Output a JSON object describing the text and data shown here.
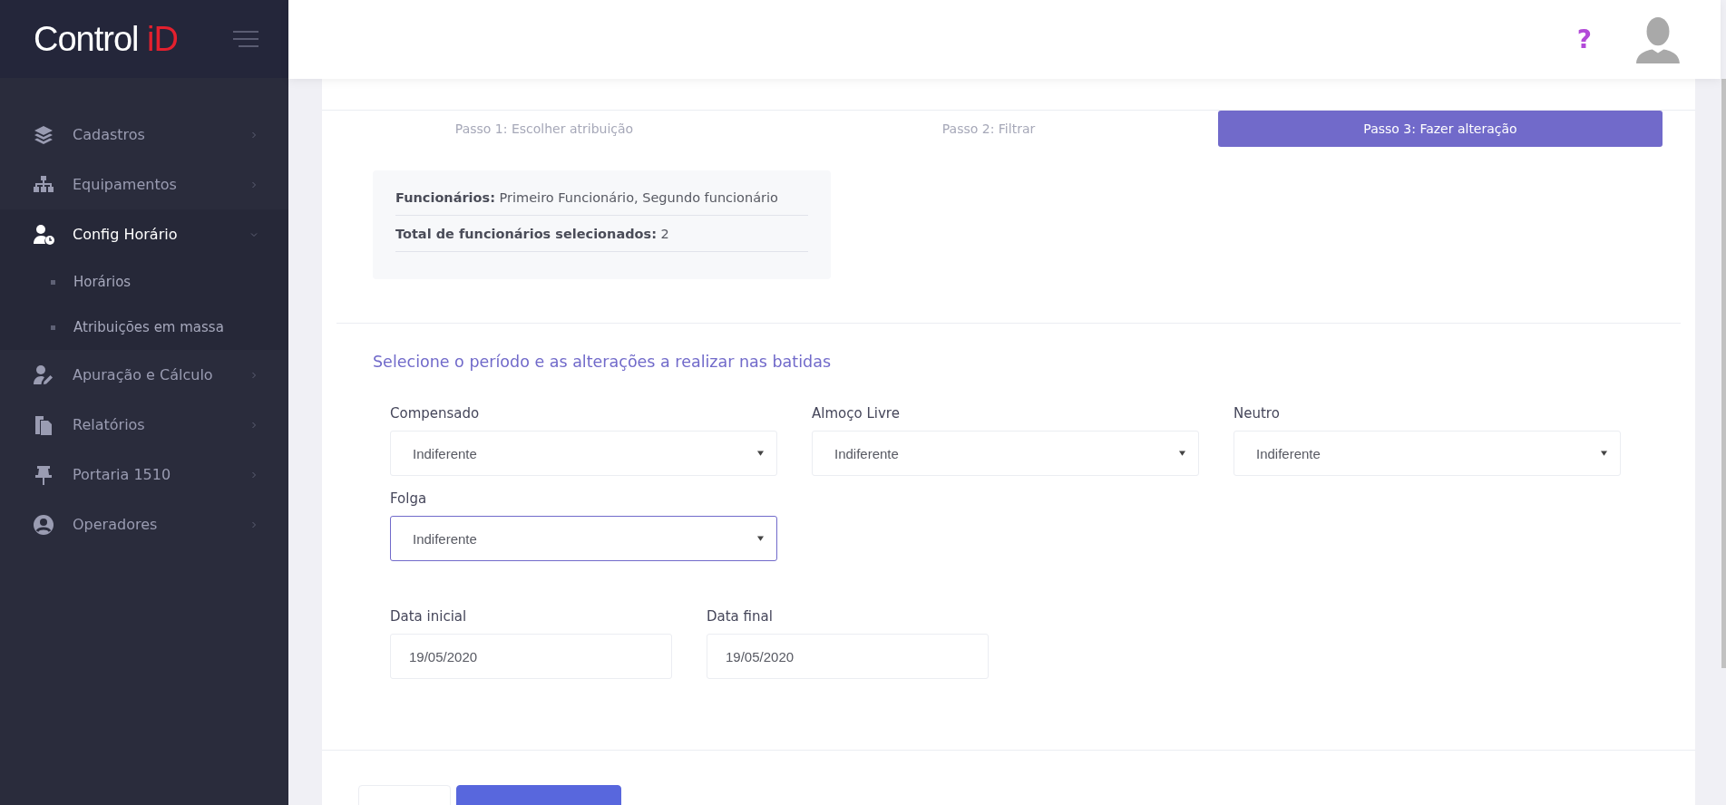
{
  "brand": {
    "name": "Control",
    "accent": "iD"
  },
  "sidebar": {
    "items": [
      {
        "label": "Cadastros",
        "expanded": false
      },
      {
        "label": "Equipamentos",
        "expanded": false
      },
      {
        "label": "Config Horário",
        "expanded": true,
        "children": [
          {
            "label": "Horários"
          },
          {
            "label": "Atribuições em massa"
          }
        ]
      },
      {
        "label": "Apuração e Cálculo",
        "expanded": false
      },
      {
        "label": "Relatórios",
        "expanded": false
      },
      {
        "label": "Portaria 1510",
        "expanded": false
      },
      {
        "label": "Operadores",
        "expanded": false
      }
    ]
  },
  "header": {
    "help": "?"
  },
  "steps": [
    {
      "label": "Passo 1: Escolher atribuição",
      "selected": false
    },
    {
      "label": "Passo 2: Filtrar",
      "selected": false
    },
    {
      "label": "Passo 3: Fazer alteração",
      "selected": true
    }
  ],
  "summary": {
    "employees_label": "Funcionários:",
    "employees": "Primeiro Funcionário, Segundo funcionário",
    "total_label": "Total de funcionários selecionados:",
    "total": "2"
  },
  "section_title": "Selecione o período e as alterações a realizar nas batidas",
  "selects": [
    {
      "label": "Compensado",
      "value": "Indiferente",
      "focused": false
    },
    {
      "label": "Almoço Livre",
      "value": "Indiferente",
      "focused": false
    },
    {
      "label": "Neutro",
      "value": "Indiferente",
      "focused": false
    },
    {
      "label": "Folga",
      "value": "Indiferente",
      "focused": true
    }
  ],
  "dates": [
    {
      "label": "Data inicial",
      "value": "19/05/2020"
    },
    {
      "label": "Data final",
      "value": "19/05/2020"
    }
  ],
  "footer_buttons": [
    {
      "kind": "secondary"
    },
    {
      "kind": "primary"
    }
  ]
}
